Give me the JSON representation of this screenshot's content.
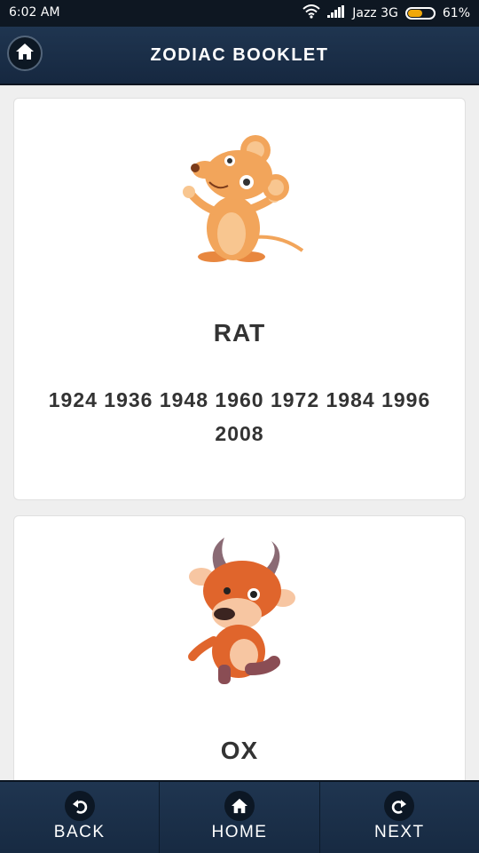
{
  "status_bar": {
    "time": "6:02 AM",
    "carrier": "Jazz 3G",
    "battery": "61%",
    "battery_level": 0.61
  },
  "header": {
    "title": "ZODIAC BOOKLET",
    "home_icon": "home-icon"
  },
  "cards": [
    {
      "name": "RAT",
      "years": "1924 1936 1948 1960 1972 1984 1996 2008",
      "image": "rat-illustration"
    },
    {
      "name": "OX",
      "image": "ox-illustration"
    }
  ],
  "bottom_nav": {
    "back_label": "BACK",
    "home_label": "HOME",
    "next_label": "NEXT",
    "back_icon": "undo-arrow-icon",
    "home_icon": "home-icon",
    "next_icon": "redo-arrow-icon"
  },
  "colors": {
    "header_bg": "#1f3550",
    "status_bg": "#0e1722",
    "battery": "#f0a80a"
  }
}
